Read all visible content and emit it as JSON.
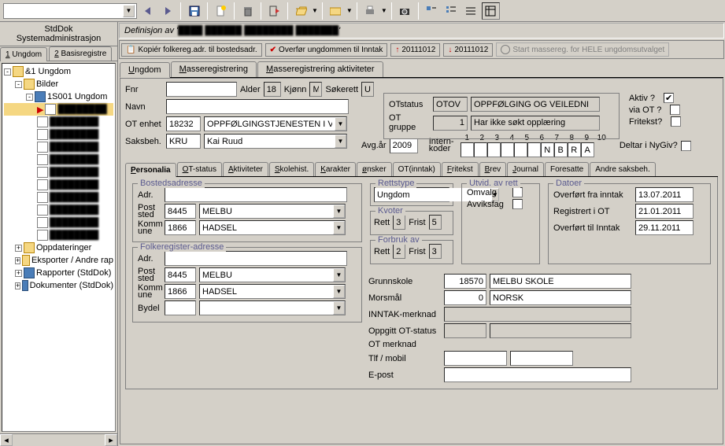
{
  "toolbar_combo": "",
  "left": {
    "title": "StdDok",
    "subtitle": "Systemadministrasjon",
    "tabs": [
      "1 Ungdom",
      "2 Basisregistre"
    ],
    "tree": {
      "root": "&1 Ungdom",
      "bilder": "Bilder",
      "s001": "1S001 Ungdom",
      "items": [
        "",
        "",
        "",
        "",
        "",
        "",
        "",
        "",
        "",
        "",
        ""
      ],
      "opp": "Oppdateringer",
      "eks": "Eksporter / Andre rap",
      "rap": "Rapporter (StdDok)",
      "dok": "Dokumenter (StdDok)"
    }
  },
  "defline": "Definisjon av '",
  "actionbar": {
    "kopier": "Kopiér folkereg.adr. til bostedsadr.",
    "overfor_inntak": "Overfør ungdommen til Inntak",
    "y1": "20111012",
    "y2": "20111012",
    "massereg": "Start massereg. for HELE ungdomsutvalget"
  },
  "maintabs": [
    "Ungdom",
    "Masseregistrering",
    "Masseregistrering aktiviteter"
  ],
  "person": {
    "fnr_lbl": "Fnr",
    "fnr": "",
    "alder_lbl": "Alder",
    "alder": "18",
    "kjonn_lbl": "Kjønn",
    "kjonn": "M",
    "sokerett_lbl": "Søkerett",
    "sokerett": "U",
    "navn_lbl": "Navn",
    "navn": "",
    "otenhet_lbl": "OT enhet",
    "otenhet_code": "18232",
    "otenhet_text": "OPPFØLGINGSTJENESTEN I VESTERÅ",
    "saksbeh_lbl": "Saksbeh.",
    "saksbeh_code": "KRU",
    "saksbeh_text": "Kai Ruud",
    "avgar_lbl": "Avg.år",
    "avgar": "2009",
    "intern_lbl": "Intern-koder",
    "intern_numbers": [
      "1",
      "2",
      "3",
      "4",
      "5",
      "6",
      "7",
      "8",
      "9",
      "10"
    ],
    "intern_vals": [
      "",
      "",
      "",
      "",
      "",
      "",
      "N",
      "B",
      "R",
      "A"
    ],
    "deltar_lbl": "Deltar i NyGiv?"
  },
  "otbox": {
    "status_lbl": "OTstatus",
    "status_code": "OTOV",
    "status_text": "OPPFØLGING OG VEILEDNI",
    "gruppe_lbl": "OT gruppe",
    "gruppe_code": "1",
    "gruppe_text": "Har ikke søkt opplæring",
    "aktiv_lbl": "Aktiv ?",
    "viaot_lbl": "via OT ?",
    "fritekst_lbl": "Fritekst?"
  },
  "subtabs": [
    "Personalia",
    "OT-status",
    "Aktiviteter",
    "Skolehist.",
    "Karakter",
    "ønsker",
    "OT(inntak)",
    "Fritekst",
    "Brev",
    "Journal",
    "Foresatte",
    "Andre saksbeh."
  ],
  "subtabs_u": [
    "P",
    "O",
    "A",
    "S",
    "K",
    "ø",
    "",
    "F",
    "B",
    "J",
    "",
    ""
  ],
  "bosted": {
    "legend": "Bostedsadresse",
    "adr_lbl": "Adr.",
    "adr": "",
    "post_lbl": "Post sted",
    "post_code": "8445",
    "post_text": "MELBU",
    "komm_lbl": "Komm une",
    "komm_code": "1866",
    "komm_text": "HADSEL"
  },
  "folkereg": {
    "legend": "Folkeregister-adresse",
    "adr_lbl": "Adr.",
    "adr": "",
    "post_lbl": "Post sted",
    "post_code": "8445",
    "post_text": "MELBU",
    "komm_lbl": "Komm une",
    "komm_code": "1866",
    "komm_text": "HADSEL",
    "bydel_lbl": "Bydel",
    "bydel": ""
  },
  "rettstype": {
    "legend": "Rettstype",
    "val": "Ungdom"
  },
  "kvoter": {
    "legend": "Kvoter",
    "rett_lbl": "Rett",
    "rett": "3",
    "frist_lbl": "Frist",
    "frist": "5"
  },
  "forbruk": {
    "legend": "Forbruk av",
    "rett_lbl": "Rett",
    "rett": "2",
    "frist_lbl": "Frist",
    "frist": "3"
  },
  "utvid": {
    "legend": "Utvid. av rett",
    "omvalg_lbl": "Omvalg",
    "avviksfag_lbl": "Avviksfag"
  },
  "datoer": {
    "legend": "Datoer",
    "o1_lbl": "Overført fra inntak",
    "o1": "13.07.2011",
    "o2_lbl": "Registrert i OT",
    "o2": "21.01.2011",
    "o3_lbl": "Overført til Inntak",
    "o3": "29.11.2011"
  },
  "rightcol": {
    "grunnskole_lbl": "Grunnskole",
    "grunnskole_code": "18570",
    "grunnskole_text": "MELBU SKOLE",
    "morsmal_lbl": "Morsmål",
    "morsmal_code": "0",
    "morsmal_text": "NORSK",
    "inntak_lbl": "INNTAK-merknad",
    "inntak": "",
    "oppgitt_lbl": "Oppgitt OT-status",
    "oppgitt": "",
    "otmerk_lbl": "OT merknad",
    "otmerk": "",
    "tlf_lbl": "Tlf / mobil",
    "tlf1": "",
    "tlf2": "",
    "epost_lbl": "E-post",
    "epost": ""
  }
}
